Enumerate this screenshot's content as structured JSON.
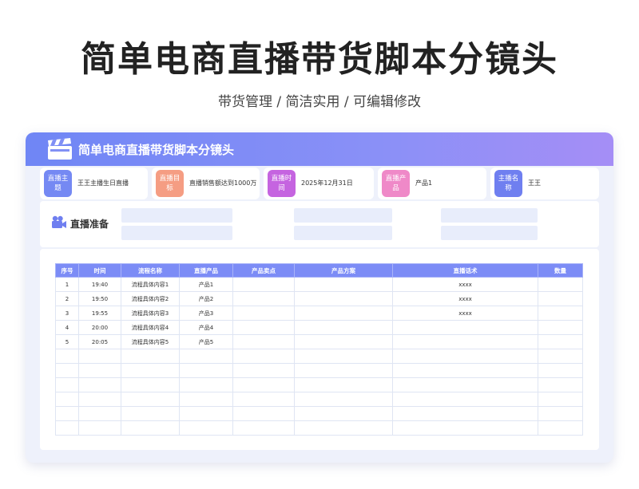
{
  "page": {
    "title": "简单电商直播带货脚本分镜头",
    "subtitle": "带货管理 / 简洁实用 /  可编辑修改"
  },
  "card": {
    "title": "简单电商直播带货脚本分镜头",
    "header_icon": "clapperboard-icon",
    "colors": {
      "header_start": "#6f86f5",
      "header_end": "#a58ef6"
    }
  },
  "info": [
    {
      "label": "直播主题",
      "value": "王王主播生日直播",
      "color": "#7589f3"
    },
    {
      "label": "直播目标",
      "value": "直播销售额达到1000万",
      "color": "#f59d83"
    },
    {
      "label": "直播时间",
      "value": "2025年12月31日",
      "color": "#c564e0"
    },
    {
      "label": "直播产品",
      "value": "产品1",
      "color": "#ef89c8"
    },
    {
      "label": "主播名称",
      "value": "王王",
      "color": "#6f7ff0"
    }
  ],
  "prep": {
    "label": "直播准备",
    "icon": "video-camera-icon"
  },
  "table": {
    "headers": [
      "序号",
      "时间",
      "流程名称",
      "直播产品",
      "产品卖点",
      "产品方案",
      "直播话术",
      "数量"
    ],
    "rows": [
      [
        "1",
        "19:40",
        "流程具体内容1",
        "产品1",
        "",
        "",
        "xxxx",
        ""
      ],
      [
        "2",
        "19:50",
        "流程具体内容2",
        "产品2",
        "",
        "",
        "xxxx",
        ""
      ],
      [
        "3",
        "19:55",
        "流程具体内容3",
        "产品3",
        "",
        "",
        "xxxx",
        ""
      ],
      [
        "4",
        "20:00",
        "流程具体内容4",
        "产品4",
        "",
        "",
        "",
        ""
      ],
      [
        "5",
        "20:05",
        "流程具体内容5",
        "产品5",
        "",
        "",
        "",
        ""
      ],
      [
        "",
        "",
        "",
        "",
        "",
        "",
        "",
        ""
      ],
      [
        "",
        "",
        "",
        "",
        "",
        "",
        "",
        ""
      ],
      [
        "",
        "",
        "",
        "",
        "",
        "",
        "",
        ""
      ],
      [
        "",
        "",
        "",
        "",
        "",
        "",
        "",
        ""
      ],
      [
        "",
        "",
        "",
        "",
        "",
        "",
        "",
        ""
      ],
      [
        "",
        "",
        "",
        "",
        "",
        "",
        "",
        ""
      ]
    ]
  }
}
